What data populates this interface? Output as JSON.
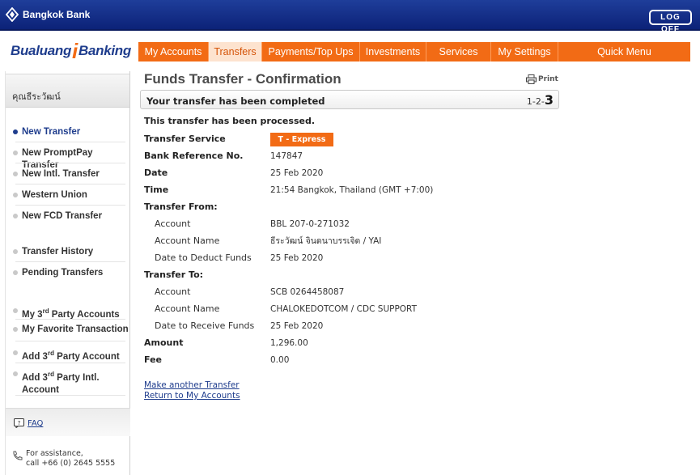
{
  "topbar": {
    "bank_name": "Bangkok Bank",
    "logoff_label": "LOG OFF"
  },
  "brand": {
    "part1": "Bualuang",
    "part2": "Banking"
  },
  "nav": {
    "tabs": [
      {
        "label": "My Accounts"
      },
      {
        "label": "Transfers"
      },
      {
        "label": "Payments/Top Ups"
      },
      {
        "label": "Investments"
      },
      {
        "label": "Services"
      },
      {
        "label": "My Settings"
      },
      {
        "label": "Quick Menu"
      }
    ],
    "active": "Transfers"
  },
  "sidebar": {
    "user_name": "คุณธีระวัฒน์",
    "items": [
      {
        "label": "New Transfer"
      },
      {
        "label": "New PromptPay Transfer"
      },
      {
        "label": "New Intl. Transfer"
      },
      {
        "label": "Western Union"
      },
      {
        "label": "New FCD Transfer"
      },
      {
        "label": "Transfer History"
      },
      {
        "label": "Pending Transfers"
      },
      {
        "label": "My 3rd Party Accounts"
      },
      {
        "label": "My Favorite Transaction"
      },
      {
        "label": "Add 3rd Party Account"
      },
      {
        "label": "Add 3rd Party Intl. Account"
      }
    ],
    "faq": "FAQ",
    "assist_line1": "For assistance,",
    "assist_line2": "call +66 (0) 2645 5555"
  },
  "main": {
    "title": "Funds Transfer - Confirmation",
    "print_label": "Print",
    "banner": "Your transfer has been completed",
    "steps_prefix": "1-2-",
    "steps_current": "3",
    "processed": "This transfer has been processed.",
    "transfer_service_label": "Transfer Service",
    "transfer_service_value": "T - Express",
    "bank_ref_label": "Bank Reference No.",
    "bank_ref_value": "147847",
    "date_label": "Date",
    "date_value": "25 Feb 2020",
    "time_label": "Time",
    "time_value": "21:54 Bangkok, Thailand (GMT +7:00)",
    "from_label": "Transfer From:",
    "from_account_label": "Account",
    "from_account_value": "BBL 207-0-271032",
    "from_name_label": "Account Name",
    "from_name_value": "ธีระวัฒน์ จินดนาบรรเจิด / YAI",
    "deduct_label": "Date to Deduct Funds",
    "deduct_value": "25 Feb 2020",
    "to_label": "Transfer To:",
    "to_account_label": "Account",
    "to_account_value": "SCB 0264458087",
    "to_name_label": "Account Name",
    "to_name_value": "CHALOKEDOTCOM / CDC SUPPORT",
    "receive_label": "Date to Receive Funds",
    "receive_value": "25 Feb 2020",
    "amount_label": "Amount",
    "amount_value": "1,296.00",
    "fee_label": "Fee",
    "fee_value": "0.00",
    "link_another": "Make another Transfer",
    "link_return": "Return to My Accounts"
  },
  "colors": {
    "brand_blue": "#1f3d8d",
    "brand_orange": "#f26b15"
  }
}
